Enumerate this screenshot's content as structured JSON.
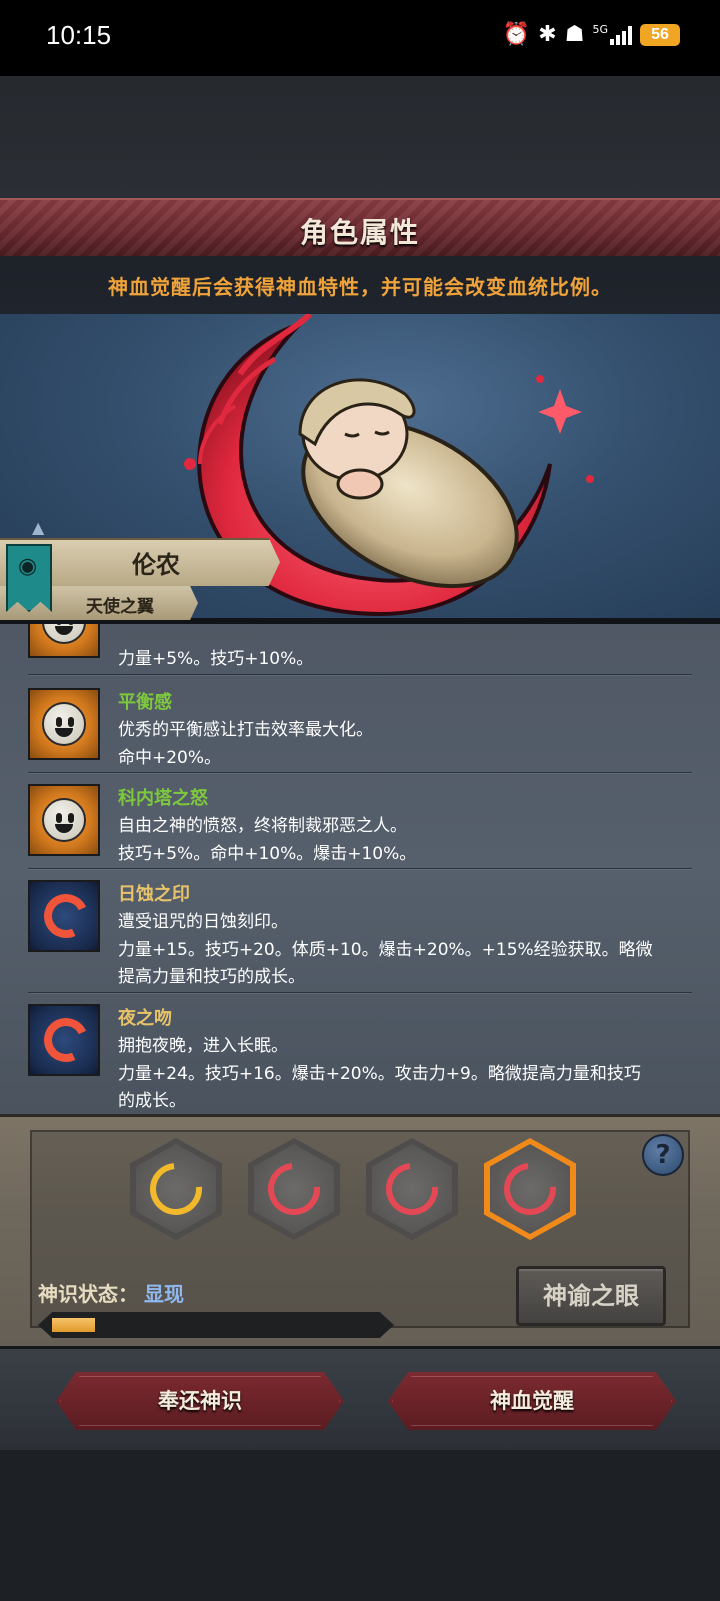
{
  "status_bar": {
    "time": "10:15",
    "network": "5G",
    "battery": "56",
    "icons": [
      "alarm-icon",
      "bluetooth-icon",
      "wifi-icon",
      "signal-icon",
      "battery-icon"
    ]
  },
  "screen": {
    "title": "角色属性",
    "notice": "神血觉醒后会获得神血特性，并可能会改变血统比例。"
  },
  "character": {
    "name": "伦农",
    "subtitle": "天使之翼"
  },
  "traits": [
    {
      "name": "",
      "icon": "sun-face-icon",
      "lines": [
        "力量+5%。技巧+10%。"
      ]
    },
    {
      "name": "平衡感",
      "name_color": "#7ec83e",
      "icon": "sun-face-icon",
      "lines": [
        "优秀的平衡感让打击效率最大化。",
        "命中+20%。"
      ]
    },
    {
      "name": "科内塔之怒",
      "name_color": "#7ec83e",
      "icon": "sun-face-icon",
      "lines": [
        "自由之神的愤怒，终将制裁邪恶之人。",
        "技巧+5%。命中+10%。爆击+10%。"
      ]
    },
    {
      "name": "日蚀之印",
      "name_color": "#e8c36a",
      "icon": "crescent-moon-icon",
      "lines": [
        "遭受诅咒的日蚀刻印。",
        "力量+15。技巧+20。体质+10。爆击+20%。+15%经验获取。略微",
        "提高力量和技巧的成长。"
      ]
    },
    {
      "name": "夜之吻",
      "name_color": "#e8c36a",
      "icon": "crescent-moon-icon",
      "lines": [
        "拥抱夜晚，进入长眠。",
        "力量+24。技巧+16。爆击+20%。攻击力+9。略微提高力量和技巧",
        "的成长。"
      ]
    }
  ],
  "divine": {
    "slots": [
      {
        "icon": "gold-crescent-icon",
        "selected": false
      },
      {
        "icon": "red-crescent-icon",
        "selected": false
      },
      {
        "icon": "red-crescent-icon",
        "selected": false
      },
      {
        "icon": "red-crescent-icon",
        "selected": true
      }
    ],
    "help": "?",
    "status_label": "神识状态：",
    "status_value": "显现",
    "progress": 0.13,
    "eye_button": "神谕之眼"
  },
  "actions": {
    "return_button": "奉还神识",
    "awaken_button": "神血觉醒"
  },
  "colors": {
    "accent_orange": "#f0a33a",
    "trait_green": "#7ec83e",
    "trait_gold": "#e8c36a",
    "status_blue": "#8fb8f0",
    "button_red": "#7b2a30"
  }
}
